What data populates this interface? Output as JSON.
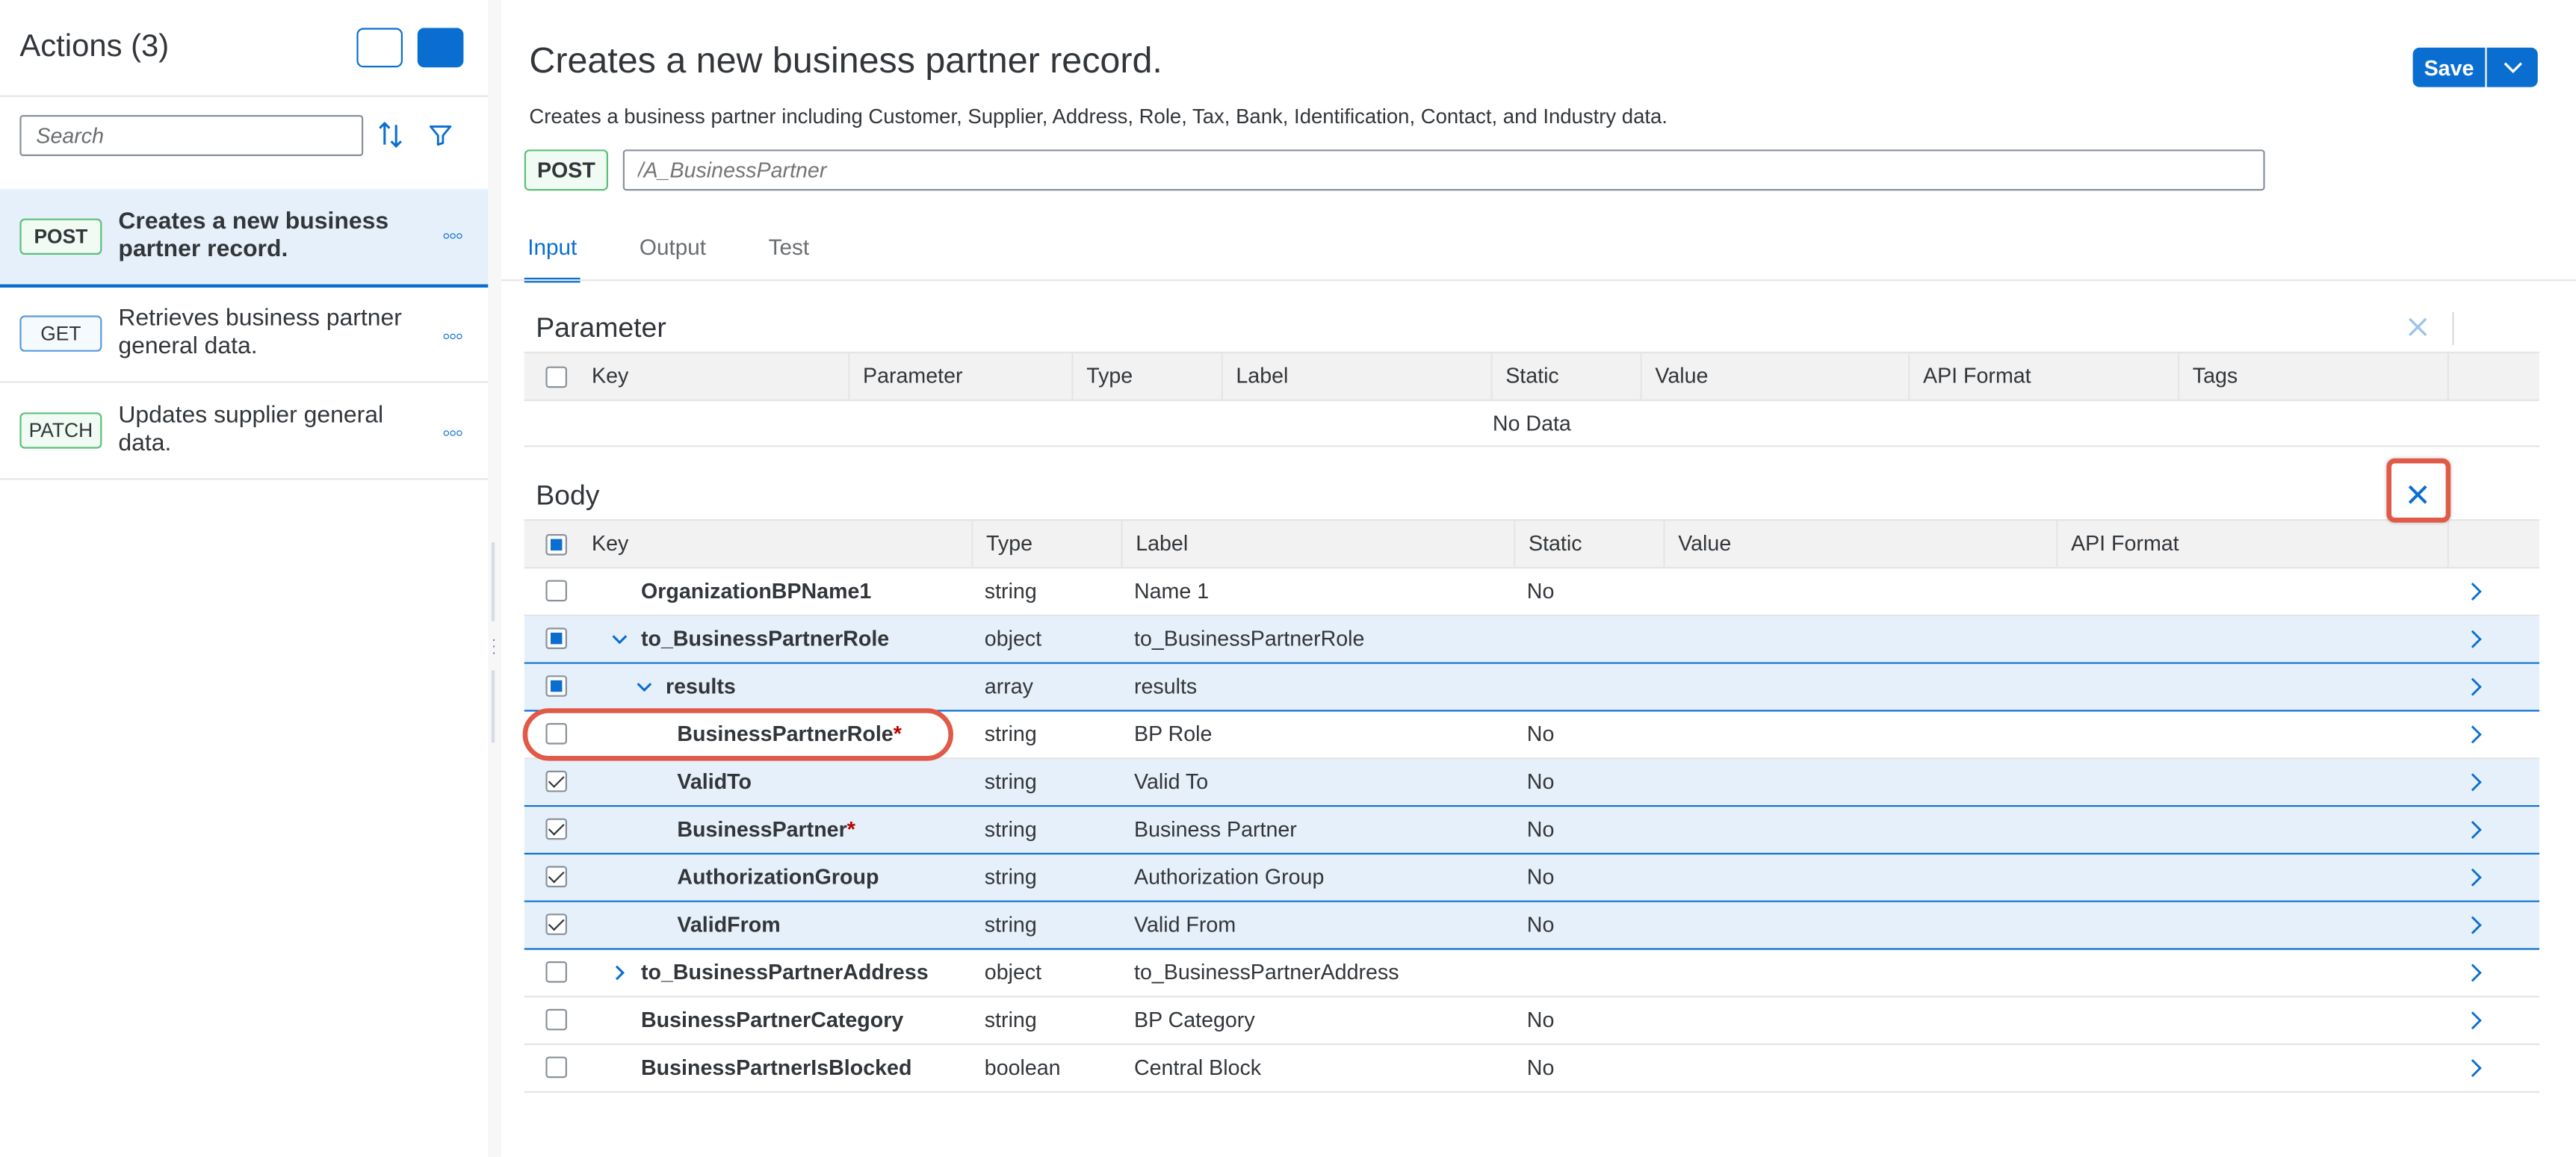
{
  "sidebar": {
    "title": "Actions (3)",
    "search_placeholder": "Search",
    "actions": [
      {
        "method": "POST",
        "label": "Creates a new business partner record.",
        "selected": true
      },
      {
        "method": "GET",
        "label": "Retrieves business partner general data.",
        "selected": false
      },
      {
        "method": "PATCH",
        "label": "Updates supplier general data.",
        "selected": false
      }
    ]
  },
  "header": {
    "title": "Creates a new business partner record.",
    "description": "Creates a business partner including Customer, Supplier, Address, Role, Tax, Bank, Identification, Contact, and Industry data.",
    "method": "POST",
    "endpoint_placeholder": "/A_BusinessPartner",
    "save_label": "Save"
  },
  "tabs": [
    "Input",
    "Output",
    "Test"
  ],
  "active_tab": "Input",
  "parameter": {
    "title": "Parameter",
    "columns": [
      "Key",
      "Parameter",
      "Type",
      "Label",
      "Static",
      "Value",
      "API Format",
      "Tags"
    ],
    "empty_text": "No Data"
  },
  "body": {
    "title": "Body",
    "columns": [
      "Key",
      "Type",
      "Label",
      "Static",
      "Value",
      "API Format"
    ],
    "rows": [
      {
        "key": "OrganizationBPName1",
        "required": false,
        "type": "string",
        "label": "Name 1",
        "static": "No",
        "check": "none",
        "level": 0,
        "expander": "none",
        "selected": false
      },
      {
        "key": "to_BusinessPartnerRole",
        "required": false,
        "type": "object",
        "label": "to_BusinessPartnerRole",
        "static": "",
        "check": "partial",
        "level": 0,
        "expander": "expanded",
        "selected": true
      },
      {
        "key": "results",
        "required": false,
        "type": "array",
        "label": "results",
        "static": "",
        "check": "partial",
        "level": 1,
        "expander": "expanded",
        "selected": true
      },
      {
        "key": "BusinessPartnerRole",
        "required": true,
        "type": "string",
        "label": "BP Role",
        "static": "No",
        "check": "none",
        "level": 2,
        "expander": "none",
        "selected": false
      },
      {
        "key": "ValidTo",
        "required": false,
        "type": "string",
        "label": "Valid To",
        "static": "No",
        "check": "checked",
        "level": 2,
        "expander": "none",
        "selected": true
      },
      {
        "key": "BusinessPartner",
        "required": true,
        "type": "string",
        "label": "Business Partner",
        "static": "No",
        "check": "checked",
        "level": 2,
        "expander": "none",
        "selected": true
      },
      {
        "key": "AuthorizationGroup",
        "required": false,
        "type": "string",
        "label": "Authorization Group",
        "static": "No",
        "check": "checked",
        "level": 2,
        "expander": "none",
        "selected": true
      },
      {
        "key": "ValidFrom",
        "required": false,
        "type": "string",
        "label": "Valid From",
        "static": "No",
        "check": "checked",
        "level": 2,
        "expander": "none",
        "selected": true
      },
      {
        "key": "to_BusinessPartnerAddress",
        "required": false,
        "type": "object",
        "label": "to_BusinessPartnerAddress",
        "static": "",
        "check": "none",
        "level": 0,
        "expander": "collapsed",
        "selected": false
      },
      {
        "key": "BusinessPartnerCategory",
        "required": false,
        "type": "string",
        "label": "BP Category",
        "static": "No",
        "check": "none",
        "level": 0,
        "expander": "none",
        "selected": false
      },
      {
        "key": "BusinessPartnerIsBlocked",
        "required": false,
        "type": "boolean",
        "label": "Central Block",
        "static": "No",
        "check": "none",
        "level": 0,
        "expander": "none",
        "selected": false
      }
    ]
  },
  "colors": {
    "accent": "#0a6ed1",
    "highlight": "#e05a47",
    "required": "#bb0000",
    "selected_row": "#e5f0fa"
  },
  "icons": [
    "sort-icon",
    "filter-icon",
    "more-icon",
    "chevron-down-icon",
    "close-icon",
    "chevron-right-icon"
  ]
}
